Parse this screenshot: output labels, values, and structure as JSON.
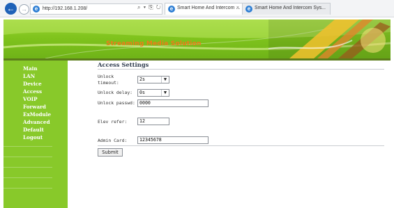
{
  "browser": {
    "address": "http://192.168.1.208/",
    "address_tools": "⌕ ▾ ⎘ ↻",
    "tabs": [
      {
        "label": "Smart Home And Intercom ...",
        "close": "×"
      },
      {
        "label": "Smart Home And Intercom Sys..."
      }
    ]
  },
  "banner": {
    "title": "Streaming Media Solution"
  },
  "sidebar": {
    "items": [
      {
        "label": "Main"
      },
      {
        "label": "LAN"
      },
      {
        "label": "Device"
      },
      {
        "label": "Access"
      },
      {
        "label": "VOIP"
      },
      {
        "label": "Forward"
      },
      {
        "label": "ExModule"
      },
      {
        "label": "Advanced"
      },
      {
        "label": "Default"
      },
      {
        "label": "Logout"
      }
    ]
  },
  "form": {
    "title": "Access Settings",
    "unlock_timeout_label_1": "Unlock",
    "unlock_timeout_label_2": "timeout:",
    "unlock_timeout_value": "2s",
    "unlock_delay_label": "Unlock delay:",
    "unlock_delay_value": "0s",
    "unlock_passwd_label": "Unlock passwd:",
    "unlock_passwd_value": "0000",
    "elev_refer_label": "Elev refer:",
    "elev_refer_value": "12",
    "admin_card_label": "Admin Card:",
    "admin_card_value": "12345678",
    "submit_label": "Submit"
  },
  "colors": {
    "sidebar_green": "#88c92a",
    "banner_title": "#ef7a1a",
    "back_button": "#1f62b8"
  }
}
